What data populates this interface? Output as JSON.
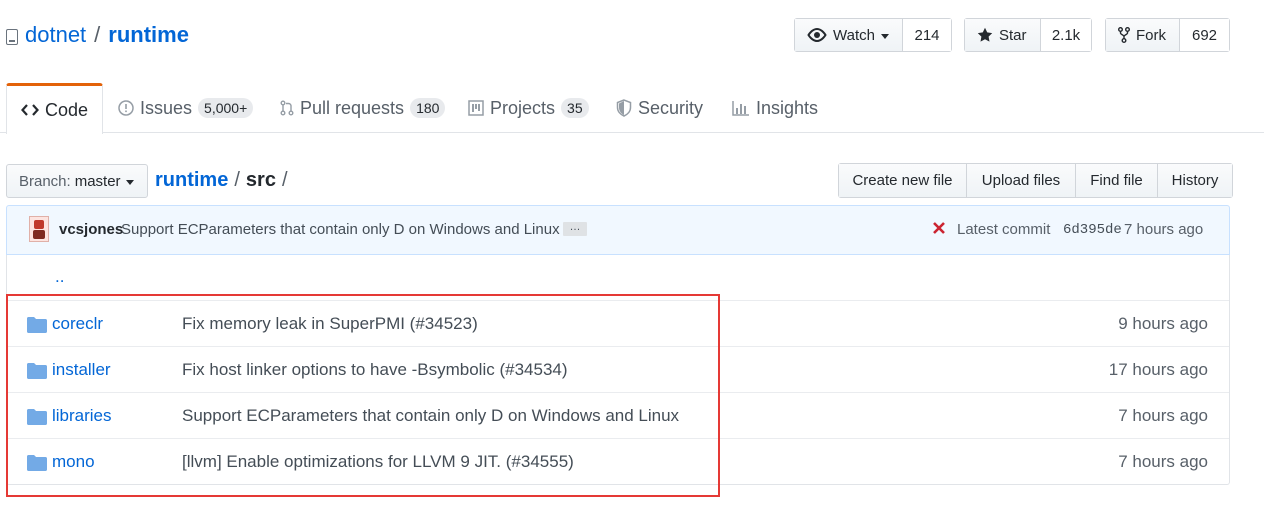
{
  "repo": {
    "owner": "dotnet",
    "separator": "/",
    "name": "runtime"
  },
  "social": {
    "watch": {
      "label": "Watch",
      "count": "214"
    },
    "star": {
      "label": "Star",
      "count": "2.1k"
    },
    "fork": {
      "label": "Fork",
      "count": "692"
    }
  },
  "tabs": [
    {
      "label": "Code",
      "counter": "",
      "icon": "code-icon",
      "selected": true
    },
    {
      "label": "Issues",
      "counter": "5,000+",
      "icon": "issue-opened-icon"
    },
    {
      "label": "Pull requests",
      "counter": "180",
      "icon": "git-pull-request-icon"
    },
    {
      "label": "Projects",
      "counter": "35",
      "icon": "project-icon"
    },
    {
      "label": "Security",
      "counter": "",
      "icon": "shield-icon"
    },
    {
      "label": "Insights",
      "counter": "",
      "icon": "graph-icon"
    }
  ],
  "branch": {
    "label": "Branch:",
    "value": "master"
  },
  "breadcrumb": {
    "root": "runtime",
    "sep1": "/",
    "current": "src",
    "sep2": "/"
  },
  "file_nav": {
    "create": "Create new file",
    "upload": "Upload files",
    "find": "Find file",
    "history": "History"
  },
  "commit": {
    "author": "vcsjones",
    "message": "Support ECParameters that contain only D on Windows and Linux",
    "ellipsis": "…",
    "latest_label": "Latest commit",
    "sha": "6d395de",
    "age": "7 hours ago",
    "status_color": "#cb2431"
  },
  "files": {
    "up": "..",
    "rows": [
      {
        "name": "coreclr",
        "message": "Fix memory leak in SuperPMI (#34523)",
        "age": "9 hours ago"
      },
      {
        "name": "installer",
        "message": "Fix host linker options to have -Bsymbolic (#34534)",
        "age": "17 hours ago"
      },
      {
        "name": "libraries",
        "message": "Support ECParameters that contain only D on Windows and Linux",
        "age": "7 hours ago"
      },
      {
        "name": "mono",
        "message": "[llvm] Enable optimizations for LLVM 9 JIT. (#34555)",
        "age": "7 hours ago"
      }
    ]
  },
  "colors": {
    "link": "#0366d6",
    "tab_accent": "#e36209",
    "highlight": "#e53935",
    "folder": "#79b8ff"
  }
}
